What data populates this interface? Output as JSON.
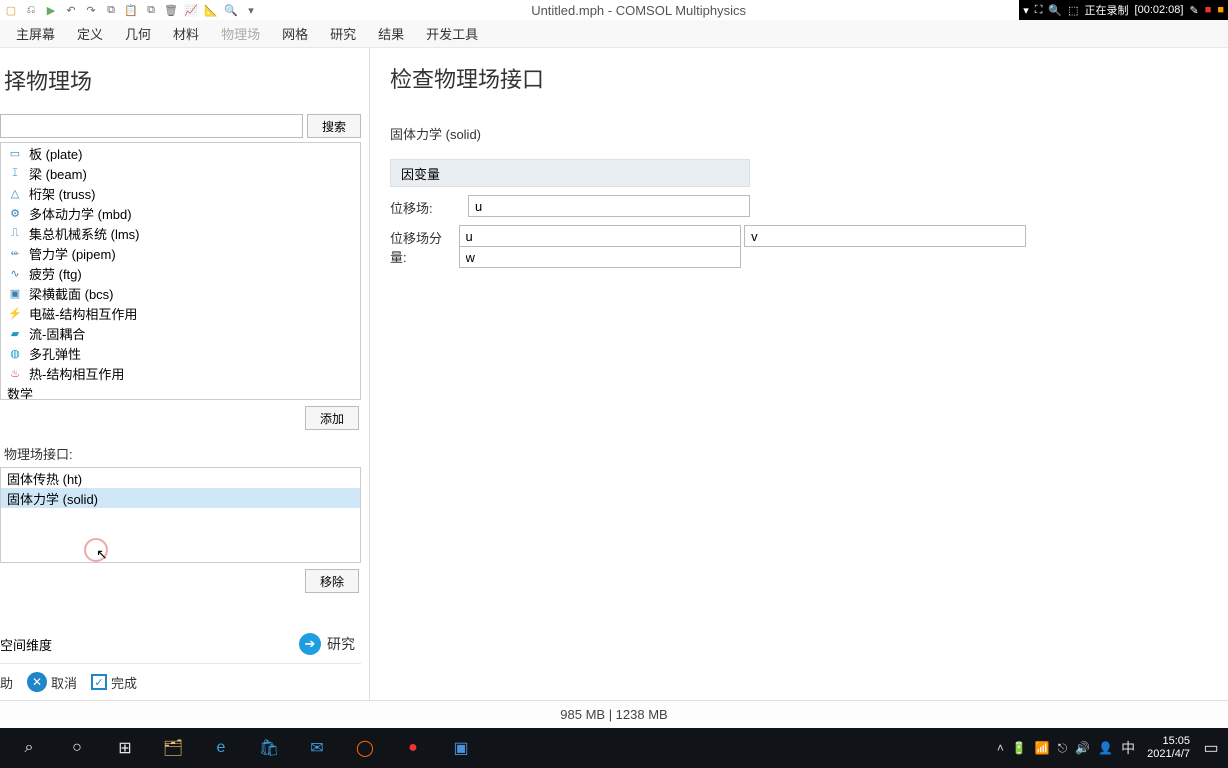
{
  "title": "Untitled.mph - COMSOL Multiphysics",
  "recorder": {
    "status": "正在录制",
    "time": "[00:02:08]"
  },
  "menu": {
    "items": [
      "主屏幕",
      "定义",
      "几何",
      "材料",
      "物理场",
      "网格",
      "研究",
      "结果",
      "开发工具"
    ],
    "disabled_index": 4
  },
  "left": {
    "title": "择物理场",
    "search_btn": "搜索",
    "add_btn": "添加",
    "remove_btn": "移除",
    "tree": [
      "板 (plate)",
      "梁 (beam)",
      "桁架 (truss)",
      "多体动力学 (mbd)",
      "集总机械系统 (lms)",
      "管力学 (pipem)",
      "疲劳 (ftg)",
      "梁横截面 (bcs)",
      "电磁-结构相互作用",
      "流-固耦合",
      "多孔弹性",
      "热-结构相互作用",
      "数学"
    ],
    "interfaces_label": "物理场接口:",
    "interfaces": [
      "固体传热 (ht)",
      "固体力学 (solid)"
    ],
    "dim_label": "空间维度",
    "study_label": "研究",
    "help_label": "助",
    "cancel_label": "取消",
    "done_label": "完成"
  },
  "right": {
    "title": "检查物理场接口",
    "subtitle": "固体力学 (solid)",
    "section": "因变量",
    "rows": [
      {
        "label": "位移场:",
        "values": [
          "u"
        ]
      },
      {
        "label": "位移场分量:",
        "values": [
          "u",
          "v",
          "w"
        ]
      }
    ]
  },
  "status": {
    "memory": "985 MB | 1238 MB"
  },
  "taskbar": {
    "ime": "中",
    "time": "15:05",
    "date": "2021/4/7"
  }
}
